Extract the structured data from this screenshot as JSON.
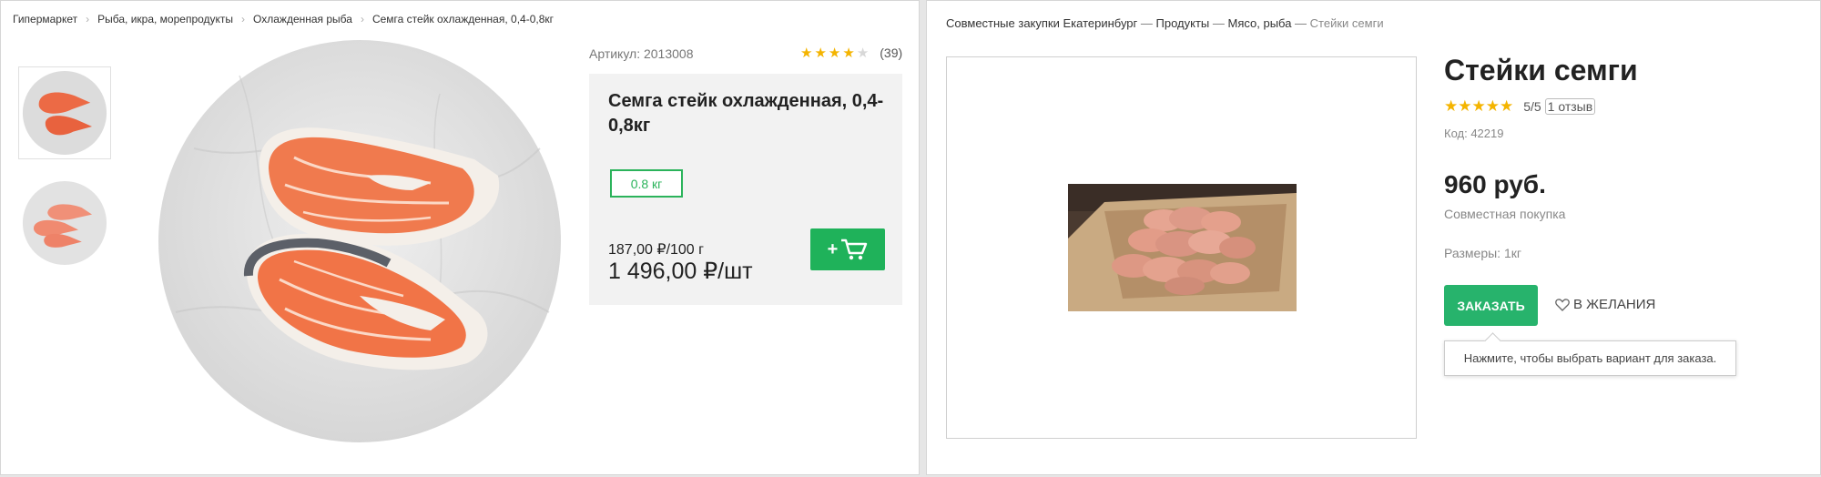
{
  "left": {
    "breadcrumb": [
      "Гипермаркет",
      "Рыба, икра, морепродукты",
      "Охлажденная рыба",
      "Семга стейк охлажденная, 0,4-0,8кг"
    ],
    "article": "Артикул: 2013008",
    "rating": {
      "value": 4,
      "max": 5,
      "count": "(39)"
    },
    "title": "Семга стейк охлажденная, 0,4-0,8кг",
    "weight": "0.8 кг",
    "price_per_unit": "187,00 ₽/100 г",
    "price_total": "1 496,00 ₽/шт",
    "cart_plus": "+"
  },
  "right": {
    "breadcrumb": [
      "Совместные закупки Екатеринбург",
      "Продукты",
      "Мясо, рыба",
      "Стейки семги"
    ],
    "breadcrumb_sep": " — ",
    "title": "Стейки семги",
    "stars": "★★★★★",
    "rating_text": "5/5",
    "reviews": "1 отзыв",
    "code": "Код: 42219",
    "price": "960 руб.",
    "purchase_type": "Совместная покупка",
    "sizes": "Размеры: 1кг",
    "order_button": "ЗАКАЗАТЬ",
    "wishlist": "В ЖЕЛАНИЯ",
    "tooltip": "Нажмите, чтобы выбрать вариант для заказа."
  },
  "colors": {
    "green": "#1fb25a",
    "star": "#f4b400",
    "star_empty": "#d8d8d8"
  },
  "icons": [
    "chevron-right-icon",
    "star-icon",
    "cart-icon",
    "heart-icon"
  ]
}
